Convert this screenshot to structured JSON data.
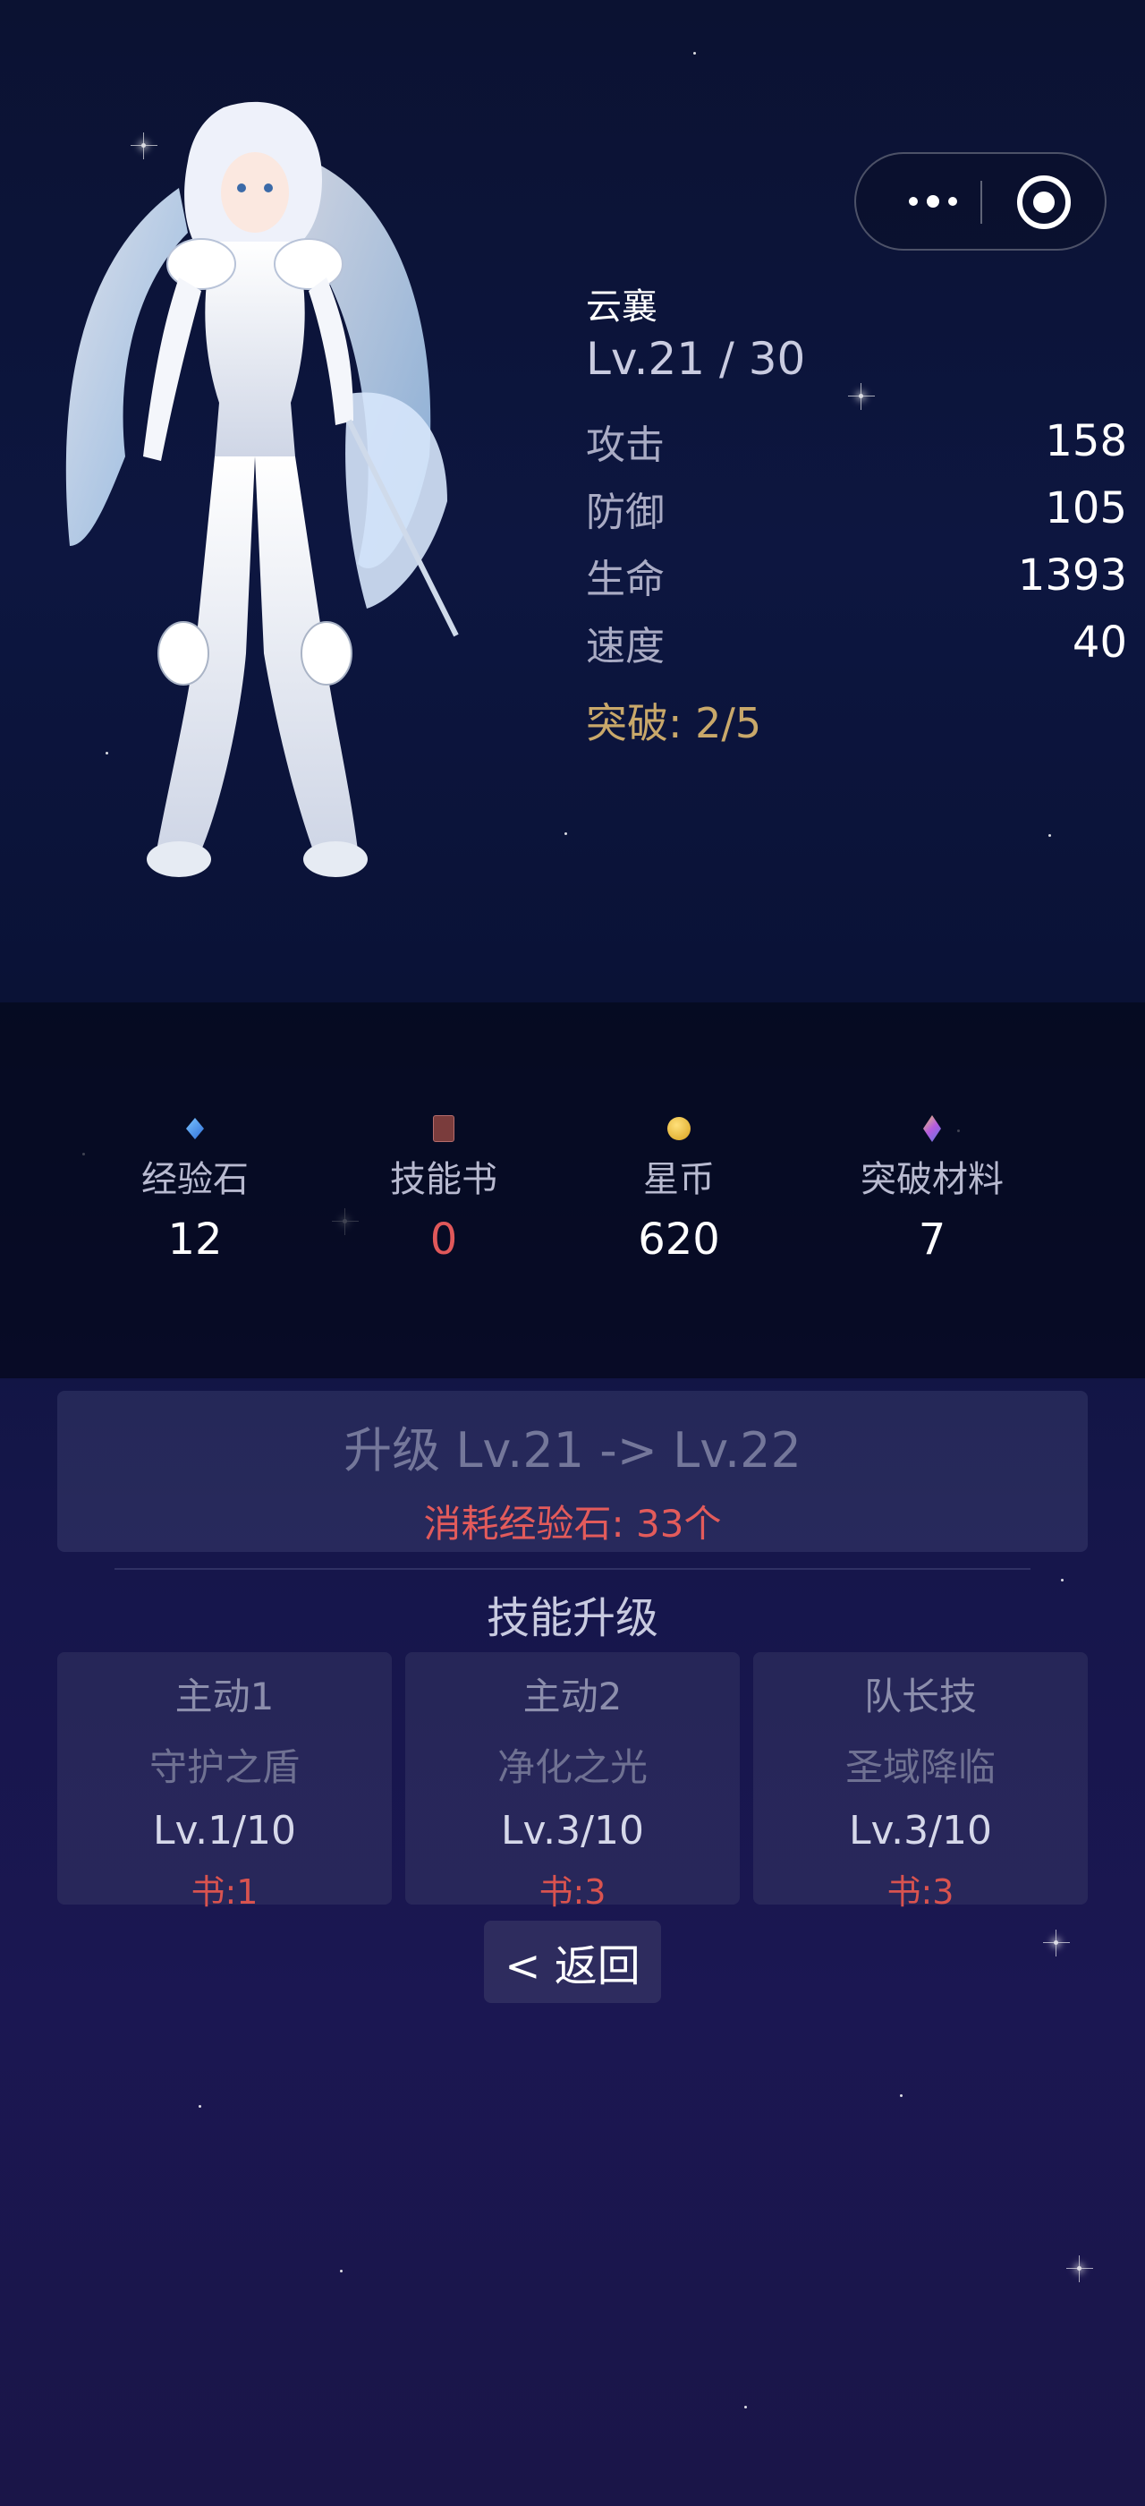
{
  "capsule": {
    "more_icon": "more-dots-icon",
    "close_icon": "target-circle-icon"
  },
  "character": {
    "name": "云襄",
    "level": "Lv.21 / 30",
    "stats": [
      {
        "label": "攻击",
        "value": "158"
      },
      {
        "label": "防御",
        "value": "105"
      },
      {
        "label": "生命",
        "value": "1393"
      },
      {
        "label": "速度",
        "value": "40"
      }
    ],
    "breakthrough": "突破: 2/5"
  },
  "resources": [
    {
      "icon": "exp-stone-icon",
      "label": "经验石",
      "value": "12",
      "color": "#ffffff"
    },
    {
      "icon": "skill-book-icon",
      "label": "技能书",
      "value": "0",
      "color": "#e0585a"
    },
    {
      "icon": "star-coin-icon",
      "label": "星币",
      "value": "620",
      "color": "#ffffff"
    },
    {
      "icon": "breakthrough-material-icon",
      "label": "突破材料",
      "value": "7",
      "color": "#ffffff"
    }
  ],
  "upgrade": {
    "title": "升级 Lv.21 -> Lv.22",
    "cost": "消耗经验石: 33个"
  },
  "skills": {
    "title": "技能升级",
    "items": [
      {
        "type": "主动1",
        "name": "守护之盾",
        "level": "Lv.1/10",
        "cost": "书:1"
      },
      {
        "type": "主动2",
        "name": "净化之光",
        "level": "Lv.3/10",
        "cost": "书:3"
      },
      {
        "type": "队长技",
        "name": "圣域降临",
        "level": "Lv.3/10",
        "cost": "书:3"
      }
    ]
  },
  "back_label": "< 返回"
}
